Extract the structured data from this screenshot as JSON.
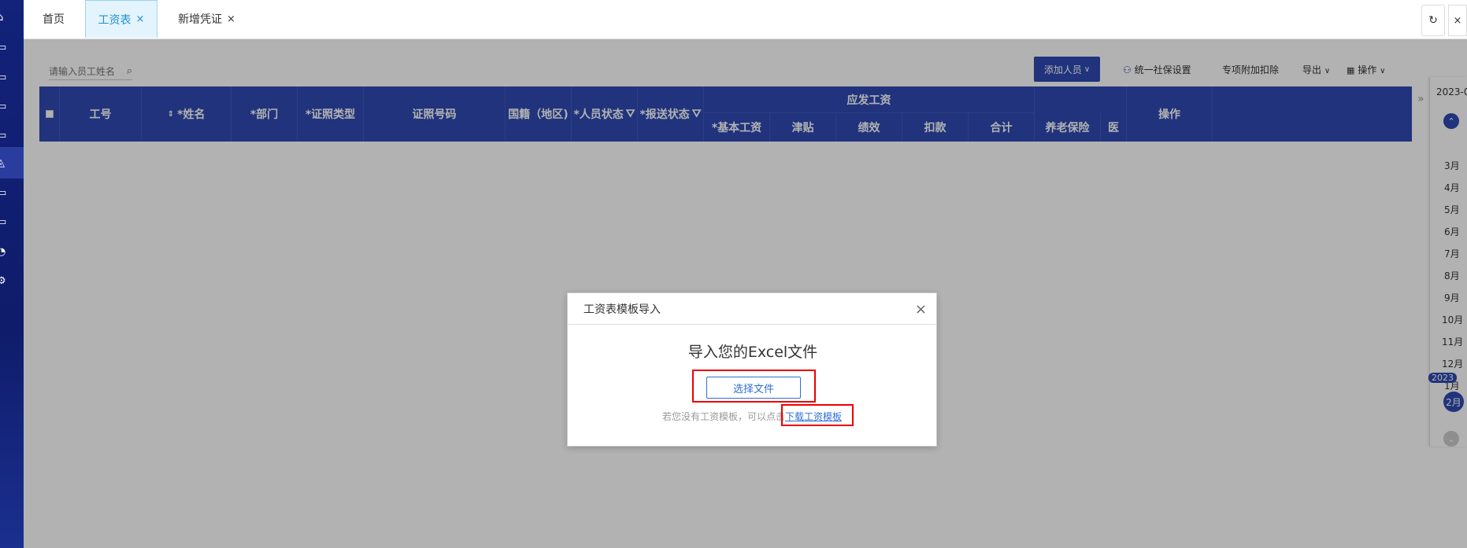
{
  "tabs": [
    {
      "label": "首页",
      "closable": false,
      "active": false
    },
    {
      "label": "工资表",
      "closable": true,
      "active": true
    },
    {
      "label": "新增凭证",
      "closable": true,
      "active": false
    }
  ],
  "tab_close_glyph": "×",
  "refresh_icon": "↻",
  "close_all_glyph": "×",
  "search": {
    "placeholder": "请输入员工姓名"
  },
  "toolbar": {
    "add_person": "添加人员",
    "social_security": "统一社保设置",
    "special_deduction": "专项附加扣除",
    "export": "导出",
    "operations": "操作"
  },
  "table": {
    "columns": [
      {
        "label": "工号"
      },
      {
        "label": "*姓名"
      },
      {
        "label": "*部门"
      },
      {
        "label": "*证照类型"
      },
      {
        "label": "证照号码"
      },
      {
        "label": "国籍（地区)"
      },
      {
        "label": "*人员状态"
      },
      {
        "label": "*报送状态"
      }
    ],
    "group_header": "应发工资",
    "sub_columns": [
      {
        "label": "*基本工资"
      },
      {
        "label": "津贴"
      },
      {
        "label": "绩效"
      },
      {
        "label": "扣款"
      },
      {
        "label": "合计"
      },
      {
        "label": "养老保险"
      },
      {
        "label": "医"
      }
    ],
    "action_column": "操作"
  },
  "month_strip": {
    "year_label": "2023-0",
    "months": [
      "3月",
      "4月",
      "5月",
      "6月",
      "7月",
      "8月",
      "9月",
      "10月",
      "11月",
      "12月",
      "1月"
    ],
    "year_badge": "2023",
    "active_month": "2月"
  },
  "collapse_arrow": "»",
  "modal": {
    "header": "工资表模板导入",
    "close": "×",
    "title": "导入您的Excel文件",
    "choose_button": "选择文件",
    "hint": "若您没有工资模板，可以点击",
    "download_link": "下载工资模板"
  },
  "colors": {
    "primary": "#2f4ab2",
    "highlight": "#ee0000"
  }
}
